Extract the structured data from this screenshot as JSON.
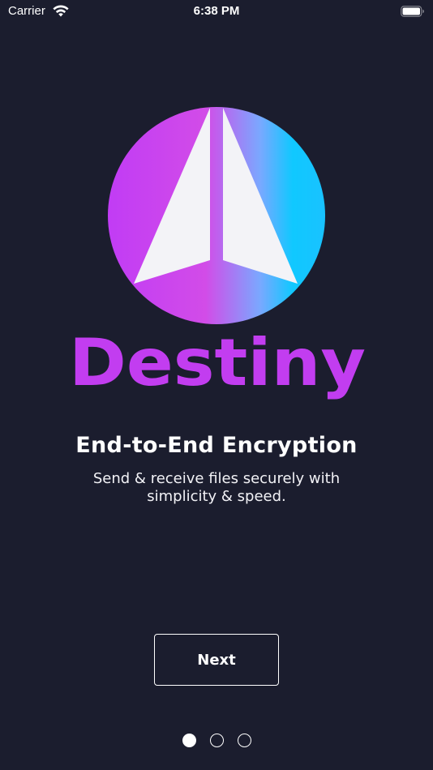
{
  "status_bar": {
    "carrier": "Carrier",
    "time": "6:38 PM"
  },
  "brand": {
    "name": "Destiny",
    "gradient_colors": [
      "#c13cf5",
      "#d24ce8",
      "#7aa8ff",
      "#10c8ff"
    ],
    "wordmark_color": "#c23df0"
  },
  "onboarding": {
    "headline": "End-to-End Encryption",
    "subtitle": "Send & receive files securely with simplicity & speed.",
    "next_label": "Next",
    "page_count": 3,
    "current_page": 1
  },
  "colors": {
    "background": "#1b1d2e",
    "text": "#ffffff"
  }
}
